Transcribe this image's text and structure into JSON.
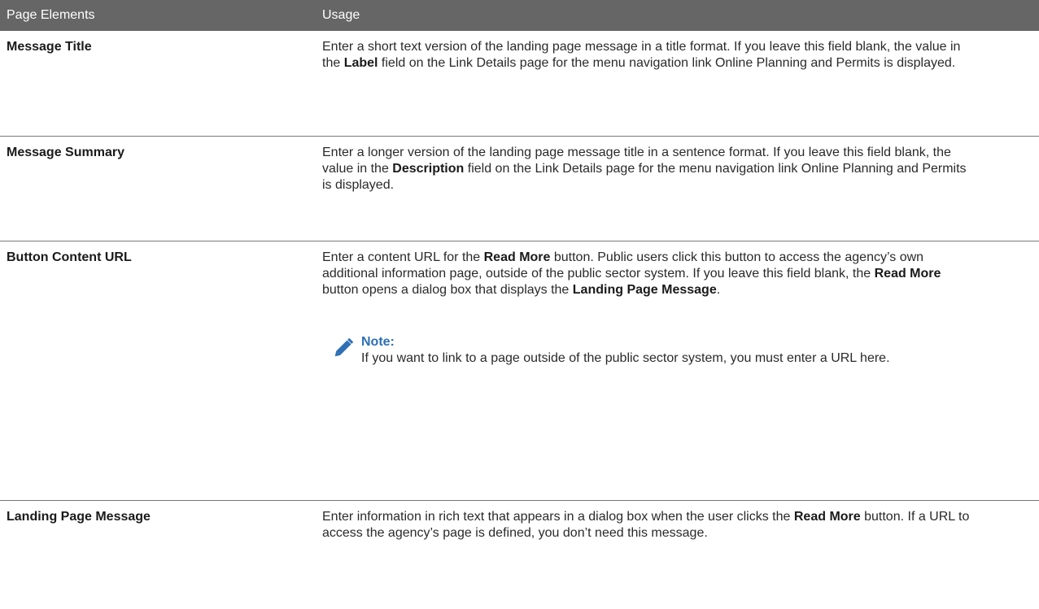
{
  "header": {
    "col1": "Page Elements",
    "col2": "Usage"
  },
  "rows": [
    {
      "element": "Message Title",
      "usage": [
        {
          "t": "Enter a short text version of the landing page message in a title format. If you leave this field blank, the value in the "
        },
        {
          "t": "Label",
          "b": true
        },
        {
          "t": " field on the Link Details page for the menu navigation link Online Planning and Permits is displayed."
        }
      ]
    },
    {
      "element": "Message Summary",
      "usage": [
        {
          "t": "Enter a longer version of the landing page message title in a sentence format. If you leave this field blank, the value in the "
        },
        {
          "t": "Description",
          "b": true
        },
        {
          "t": " field on the Link Details page for the menu navigation link Online Planning and Permits is displayed."
        }
      ]
    },
    {
      "element": "Button Content URL",
      "usage": [
        {
          "t": "Enter a content URL for the "
        },
        {
          "t": "Read More",
          "b": true
        },
        {
          "t": " button. Public users click this button to access the agency’s own additional information page, outside of the public sector system. If you leave this field blank, the "
        },
        {
          "t": "Read More",
          "b": true
        },
        {
          "t": " button opens a dialog box that displays the "
        },
        {
          "t": "Landing Page Message",
          "b": true
        },
        {
          "t": "."
        }
      ],
      "note": {
        "title": "Note:",
        "body": "If you want to link to a page outside of the public sector system, you must enter a URL here.",
        "icon": "pencil-icon"
      }
    },
    {
      "element": "Landing Page Message",
      "usage": [
        {
          "t": "Enter information in rich text that appears in a dialog box when the user clicks the "
        },
        {
          "t": "Read More",
          "b": true
        },
        {
          "t": " button. If a URL to access the agency’s page is defined, you don’t need this message."
        }
      ]
    }
  ],
  "colors": {
    "header_bg": "#666666",
    "note_title": "#2e6fb5",
    "pencil_icon": "#2e6fb5"
  }
}
